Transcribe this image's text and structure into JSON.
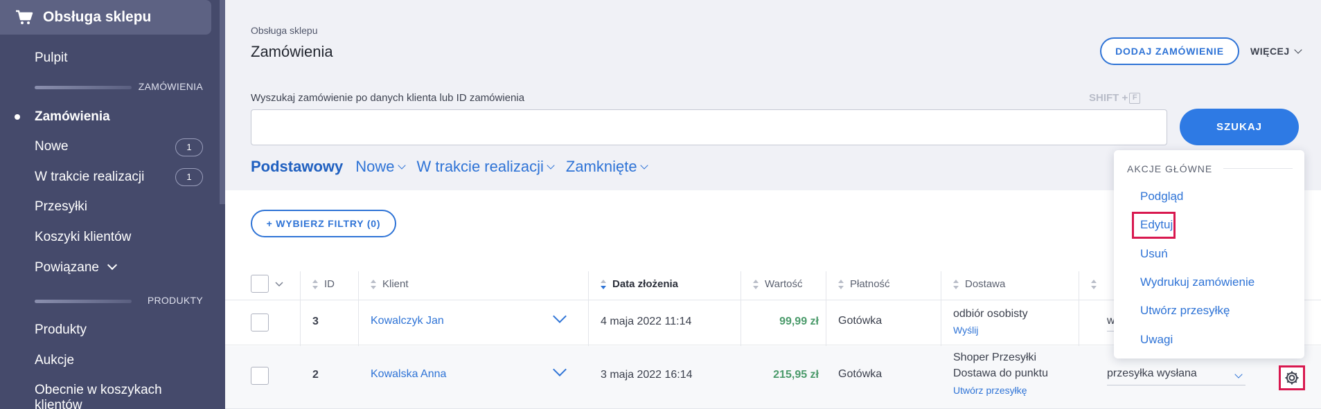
{
  "sidebar": {
    "header": "Obsługa sklepu",
    "items": {
      "pulpit": "Pulpit",
      "section_orders": "ZAMÓWIENIA",
      "zamowienia": "Zamówienia",
      "nowe": "Nowe",
      "nowe_badge": "1",
      "w_trakcie": "W trakcie realizacji",
      "w_trakcie_badge": "1",
      "przesylki": "Przesyłki",
      "koszyki": "Koszyki klientów",
      "powiazane": "Powiązane",
      "section_products": "PRODUKTY",
      "produkty": "Produkty",
      "aukcje": "Aukcje",
      "obecnie_line1": "Obecnie w koszykach",
      "obecnie_line2": "klientów"
    }
  },
  "header": {
    "breadcrumb": "Obsługa sklepu",
    "title": "Zamówienia",
    "add_order": "DODAJ ZAMÓWIENIE",
    "more": "WIĘCEJ"
  },
  "search": {
    "label": "Wyszukaj zamówienie po danych klienta lub ID zamówienia",
    "shortcut": "SHIFT +",
    "shortcut_key": "F",
    "value": "",
    "button": "SZUKAJ"
  },
  "tabs": [
    "Podstawowy",
    "Nowe",
    "W trakcie realizacji",
    "Zamknięte"
  ],
  "filters": {
    "label": "+ WYBIERZ FILTRY (0)"
  },
  "table": {
    "columns": {
      "id": "ID",
      "client": "Klient",
      "date": "Data złożenia",
      "value": "Wartość",
      "payment": "Płatność",
      "delivery": "Dostawa"
    },
    "rows": [
      {
        "id": "3",
        "client": "Kowalczyk Jan",
        "date": "4 maja 2022 11:14",
        "value": "99,99 zł",
        "payment": "Gotówka",
        "delivery": "odbiór osobisty",
        "delivery_link": "Wyślij",
        "status": "w"
      },
      {
        "id": "2",
        "client": "Kowalska Anna",
        "date": "3 maja 2022 16:14",
        "value": "215,95 zł",
        "payment": "Gotówka",
        "delivery_line1": "Shoper Przesyłki",
        "delivery_line2": "Dostawa do punktu",
        "delivery_link": "Utwórz przesyłkę",
        "status": "przesyłka wysłana"
      }
    ]
  },
  "menu": {
    "title": "AKCJE GŁÓWNE",
    "items": [
      "Podgląd",
      "Edytuj",
      "Usuń",
      "Wydrukuj zamówienie",
      "Utwórz przesyłkę",
      "Uwagi"
    ]
  },
  "colors": {
    "sidebar_bg": "#454a6b",
    "accent": "#2e73d6",
    "value_green": "#4a9a6a",
    "highlight": "#d8184f"
  }
}
